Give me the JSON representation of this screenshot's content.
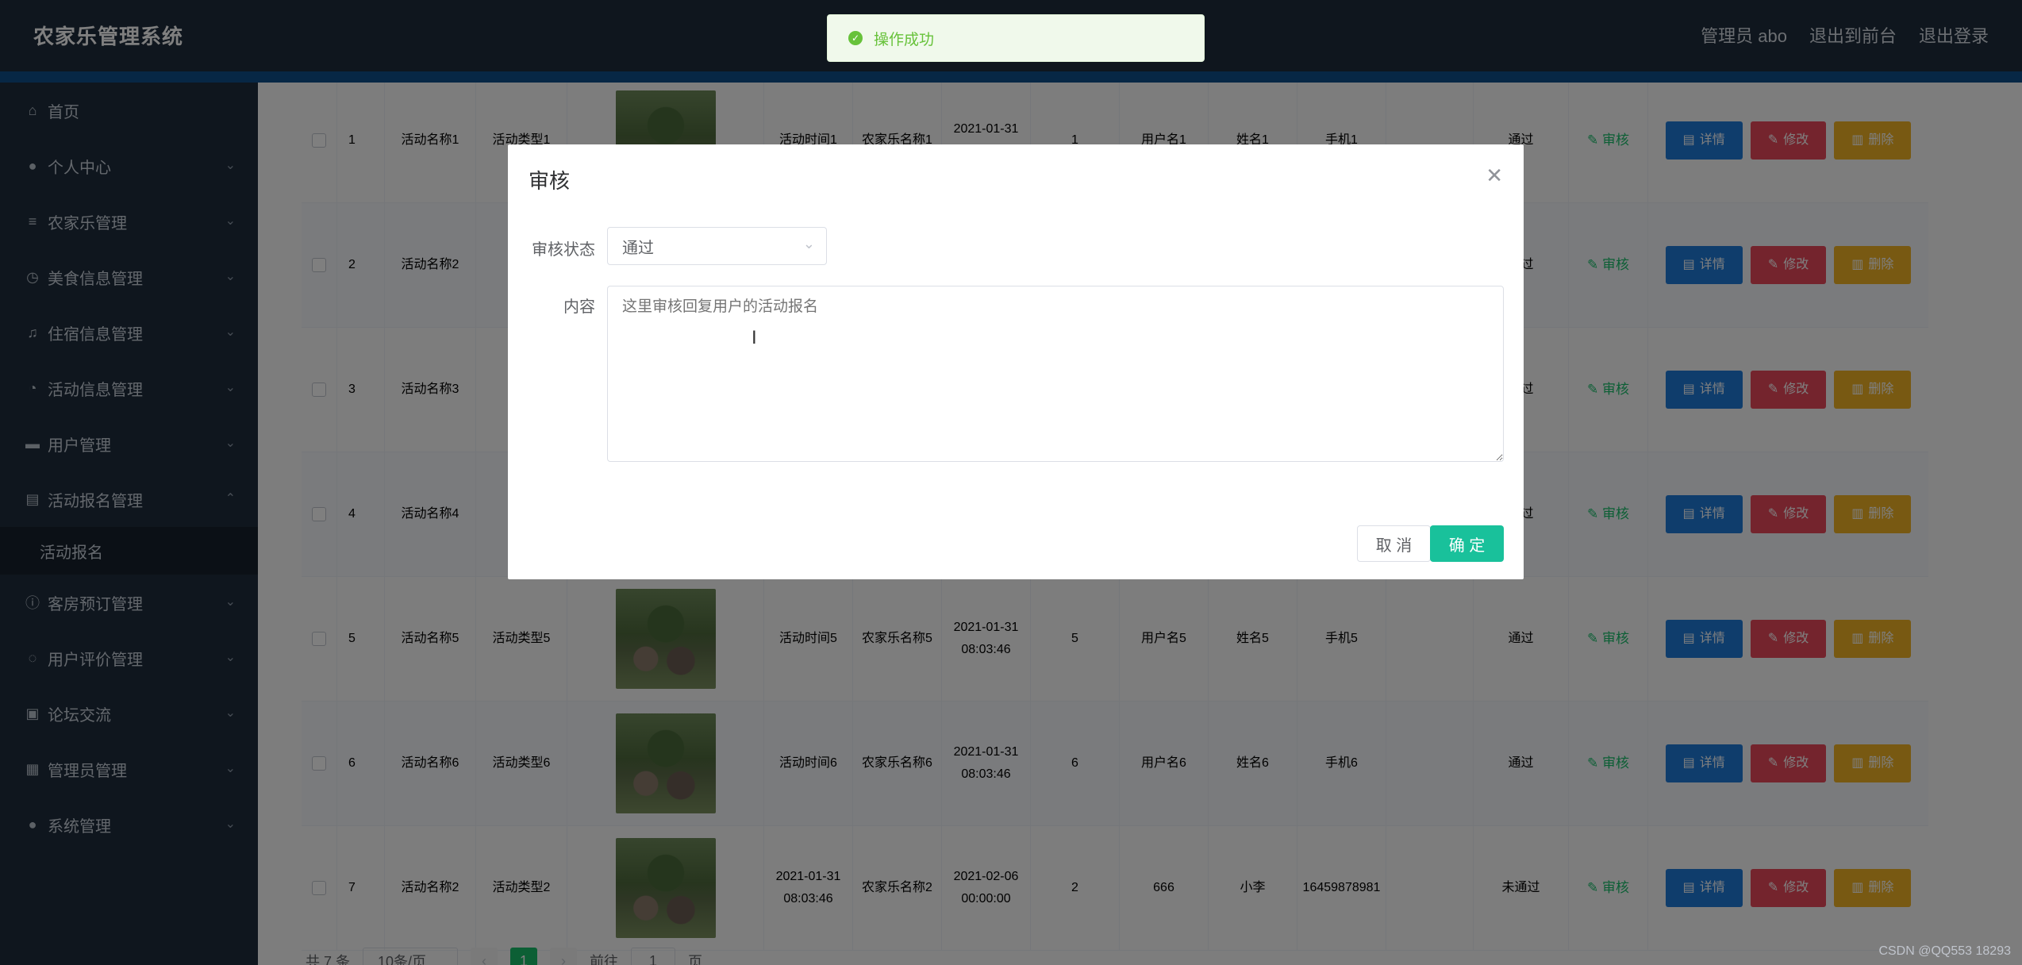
{
  "header": {
    "brand": "农家乐管理系统",
    "admin_label": "管理员 abo",
    "to_front": "退出到前台",
    "logout": "退出登录"
  },
  "sidebar": {
    "items": [
      {
        "label": "首页",
        "icon": "home-icon"
      },
      {
        "label": "个人中心",
        "icon": "user-icon"
      },
      {
        "label": "农家乐管理",
        "icon": "list-icon"
      },
      {
        "label": "美食信息管理",
        "icon": "clock-icon"
      },
      {
        "label": "住宿信息管理",
        "icon": "bell-icon"
      },
      {
        "label": "活动信息管理",
        "icon": "check-circle-icon"
      },
      {
        "label": "用户管理",
        "icon": "monitor-icon"
      },
      {
        "label": "活动报名管理",
        "icon": "document-icon"
      },
      {
        "label": "客房预订管理",
        "icon": "info-icon"
      },
      {
        "label": "用户评价管理",
        "icon": "globe-icon"
      },
      {
        "label": "论坛交流",
        "icon": "suitcase-icon"
      },
      {
        "label": "管理员管理",
        "icon": "clipboard-icon"
      },
      {
        "label": "系统管理",
        "icon": "user-icon"
      }
    ],
    "submenu_active": "活动报名"
  },
  "table": {
    "rows": [
      {
        "idx": "1",
        "name": "活动名称1",
        "type": "活动类型1",
        "time": "活动时间1",
        "farm": "农家乐名称1",
        "date": "2021-01-31 08:03:46",
        "num": "1",
        "user": "用户名1",
        "realname": "姓名1",
        "phone": "手机1",
        "status": "通过"
      },
      {
        "idx": "2",
        "name": "活动名称2",
        "type": "",
        "time": "",
        "farm": "",
        "date": "",
        "num": "",
        "user": "",
        "realname": "",
        "phone": "",
        "status": "通过"
      },
      {
        "idx": "3",
        "name": "活动名称3",
        "type": "",
        "time": "",
        "farm": "",
        "date": "",
        "num": "",
        "user": "",
        "realname": "",
        "phone": "",
        "status": "通过"
      },
      {
        "idx": "4",
        "name": "活动名称4",
        "type": "",
        "time": "",
        "farm": "",
        "date": "",
        "num": "",
        "user": "",
        "realname": "",
        "phone": "",
        "status": "通过"
      },
      {
        "idx": "5",
        "name": "活动名称5",
        "type": "活动类型5",
        "time": "活动时间5",
        "farm": "农家乐名称5",
        "date": "2021-01-31 08:03:46",
        "num": "5",
        "user": "用户名5",
        "realname": "姓名5",
        "phone": "手机5",
        "status": "通过"
      },
      {
        "idx": "6",
        "name": "活动名称6",
        "type": "活动类型6",
        "time": "活动时间6",
        "farm": "农家乐名称6",
        "date": "2021-01-31 08:03:46",
        "num": "6",
        "user": "用户名6",
        "realname": "姓名6",
        "phone": "手机6",
        "status": "通过"
      },
      {
        "idx": "7",
        "name": "活动名称2",
        "type": "活动类型2",
        "time": "2021-01-31 08:03:46",
        "farm": "农家乐名称2",
        "date": "2021-02-06 00:00:00",
        "num": "2",
        "user": "666",
        "realname": "小李",
        "phone": "16459878981",
        "status": "未通过"
      }
    ],
    "audit_label": "审核",
    "detail_label": "详情",
    "edit_label": "修改",
    "delete_label": "删除"
  },
  "pagination": {
    "total": "共 7 条",
    "page_size": "10条/页",
    "current": "1",
    "goto_label": "前往",
    "goto_value": "1",
    "page_unit": "页"
  },
  "toast": {
    "message": "操作成功"
  },
  "dialog": {
    "title": "审核",
    "status_label": "审核状态",
    "status_value": "通过",
    "content_label": "内容",
    "content_value": "这里审核回复用户的活动报名",
    "cancel": "取 消",
    "confirm": "确 定"
  },
  "watermark": "CSDN @QQ553 18293",
  "colors": {
    "header_bg": "#1f2d3d",
    "accent": "#19c19b",
    "detail": "#1f7ad8",
    "edit": "#e8495b",
    "delete": "#f1b224"
  }
}
